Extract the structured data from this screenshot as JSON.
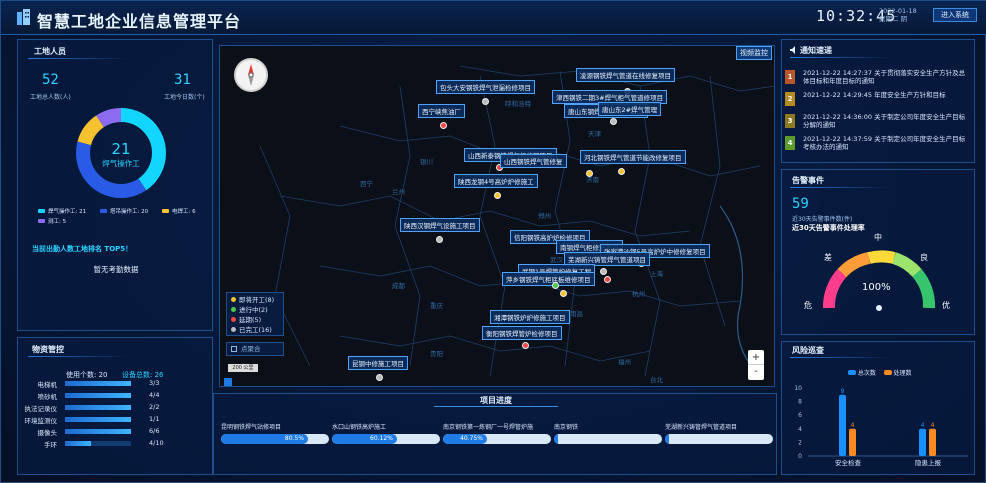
{
  "header": {
    "title": "智慧工地企业信息管理平台",
    "time": "10:32:45",
    "date": "2022-01-18",
    "weekday": "星期二 阴",
    "enter_label": "进入系统"
  },
  "workers": {
    "title": "工地人员",
    "total_value": "52",
    "total_label": "工地总人数(人)",
    "today_value": "31",
    "today_label": "工地今日数(个)",
    "center_value": "21",
    "center_label": "焊气操作工",
    "legend": [
      {
        "label": "焊气操作工",
        "value": "21",
        "color": "#12d6ff"
      },
      {
        "label": "塔吊操作工",
        "value": "20",
        "color": "#2a5be6"
      },
      {
        "label": "电焊工",
        "value": "6",
        "color": "#f6c22f"
      },
      {
        "label": "测工",
        "value": "5",
        "color": "#8d6bf0"
      }
    ],
    "attendance_title": "当前出勤人数工地排名 TOP5！",
    "attendance_empty": "暂无考勤数据"
  },
  "materials": {
    "title": "物资管控",
    "used_label": "使用个数: 20",
    "total_label": "设备总数: 26",
    "items": [
      {
        "label": "电梯机",
        "value": "3/3",
        "ratio": 1.0
      },
      {
        "label": "喷砂机",
        "value": "4/4",
        "ratio": 1.0
      },
      {
        "label": "执法记录仪",
        "value": "2/2",
        "ratio": 1.0
      },
      {
        "label": "环境监测仪",
        "value": "1/1",
        "ratio": 1.0
      },
      {
        "label": "摄像头",
        "value": "6/6",
        "ratio": 1.0
      },
      {
        "label": "手环",
        "value": "4/10",
        "ratio": 0.4
      }
    ]
  },
  "map": {
    "monitor_label": "视频监控",
    "legend": [
      {
        "label": "即将开工(8)",
        "color": "#f6c22f"
      },
      {
        "label": "进行中(2)",
        "color": "#4ac94a"
      },
      {
        "label": "延期(5)",
        "color": "#f04747"
      },
      {
        "label": "已完工(16)",
        "color": "#bbbbbb"
      }
    ],
    "aggregate_label": "点聚合",
    "scale_label": "200 公里",
    "zoom_in": "+",
    "zoom_out": "-",
    "cities": [
      "呼和浩特",
      "银川",
      "西宁",
      "兰州",
      "天津",
      "济南",
      "郑州",
      "西安",
      "武汉",
      "南京",
      "合肥",
      "上海",
      "杭州",
      "成都",
      "重庆",
      "贵阳",
      "长沙",
      "南昌",
      "福州",
      "台北"
    ],
    "projects": [
      {
        "label": "凌源钢铁焊气管道在线修复项目",
        "status": "已完工"
      },
      {
        "label": "包头大安钢铁焊气泄漏检修项目",
        "status": "已完工"
      },
      {
        "label": "西宁峡焦油厂",
        "status": "延期"
      },
      {
        "label": "津西钢铁二期3#焊气柜气管道修项目",
        "status": "已完工"
      },
      {
        "label": "唐山东钢焊气站3焊气管道",
        "status": "已完工"
      },
      {
        "label": "唐山东2#焊气管理",
        "status": "已完工"
      },
      {
        "label": "山西新泰钢铁焊气柜修理项目",
        "status": "延期"
      },
      {
        "label": "山西钢铁焊气管修复",
        "status": "即将开工"
      },
      {
        "label": "河北钢铁焊气管道节能改修复项目",
        "status": "即将开工"
      },
      {
        "label": "陕西龙钢4号高炉炉修施工",
        "status": "即将开工"
      },
      {
        "label": "陕西汉钢焊气设施工项目",
        "status": "已完工"
      },
      {
        "label": "信阳钢铁高炉炉检修项目",
        "status": "即将开工"
      },
      {
        "label": "南钢焊气柜修复项目",
        "status": "已完工"
      },
      {
        "label": "张家港沙钢5号高炉炉中修修复项目",
        "status": "已完工"
      },
      {
        "label": "芜湖新兴铸管焊气管道项目",
        "status": "已完工"
      },
      {
        "label": "武钢1号焊管炉修复工程",
        "status": "延期"
      },
      {
        "label": "萍乡钢铁焊气柜底板维修项目",
        "status": "进行中"
      },
      {
        "label": "湘潭钢铁炉炉修施工项目",
        "status": "已完工"
      },
      {
        "label": "衡阳钢铁焊管炉检修项目",
        "status": "延期"
      },
      {
        "label": "昆钢中修施工项目",
        "status": "已完工"
      }
    ]
  },
  "progress": {
    "title": "项目进度",
    "items": [
      {
        "name": "昆明钢铁焊气站修项目",
        "percent_label": "80.5%",
        "percent": 80.5
      },
      {
        "name": "水口山钢铁高炉施工",
        "percent_label": "60.12%",
        "percent": 60.12
      },
      {
        "name": "南京钢铁第一炼钢厂一号焊管炉施",
        "percent_label": "40.75%",
        "percent": 40.75
      },
      {
        "name": "南京钢铁",
        "percent_label": "",
        "percent": 0
      },
      {
        "name": "芜湖新兴铸管焊气管道项目",
        "percent_label": "",
        "percent": 0
      }
    ]
  },
  "notices": {
    "title": "通知速递",
    "items": [
      {
        "index": "1",
        "color": "#b9562b",
        "text": "2021-12-22 14:27:37 关于贯彻落实安全生产方针及总体目标和年度目标的通知"
      },
      {
        "index": "2",
        "color": "#b58a1e",
        "text": "2021-12-22 14:29:45 年度安全生产方针和目标"
      },
      {
        "index": "3",
        "color": "#8c7a20",
        "text": "2021-12-22 14:36:00 关于制定公司年度安全生产目标分解的通知"
      },
      {
        "index": "4",
        "color": "#5d9b2b",
        "text": "2021-12-22 14:37:59 关于制定公司年度安全生产目标考核办法的通知"
      }
    ]
  },
  "alarms": {
    "title": "告警事件",
    "count": "59",
    "count_label": "近30天告警事件数(件)",
    "rate_title": "近30天告警事件处理率",
    "gauge_value": "100%",
    "gauge_percent": 100,
    "gauge_labels": {
      "bad": "差",
      "mid": "中",
      "good": "良",
      "danger": "危",
      "excellent": "优"
    }
  },
  "risk": {
    "title": "风险巡查",
    "legend": [
      {
        "label": "总次数",
        "color": "#1a8fff"
      },
      {
        "label": "处理数",
        "color": "#ff8a1f"
      }
    ],
    "chart_data": {
      "type": "bar",
      "categories": [
        "安全检查",
        "隐患上报"
      ],
      "series": [
        {
          "name": "总次数",
          "values": [
            9,
            4
          ]
        },
        {
          "name": "处理数",
          "values": [
            4,
            4
          ]
        }
      ],
      "yticks": [
        "0",
        "2",
        "4",
        "6",
        "8",
        "10"
      ],
      "ylim": [
        0,
        10
      ]
    }
  }
}
